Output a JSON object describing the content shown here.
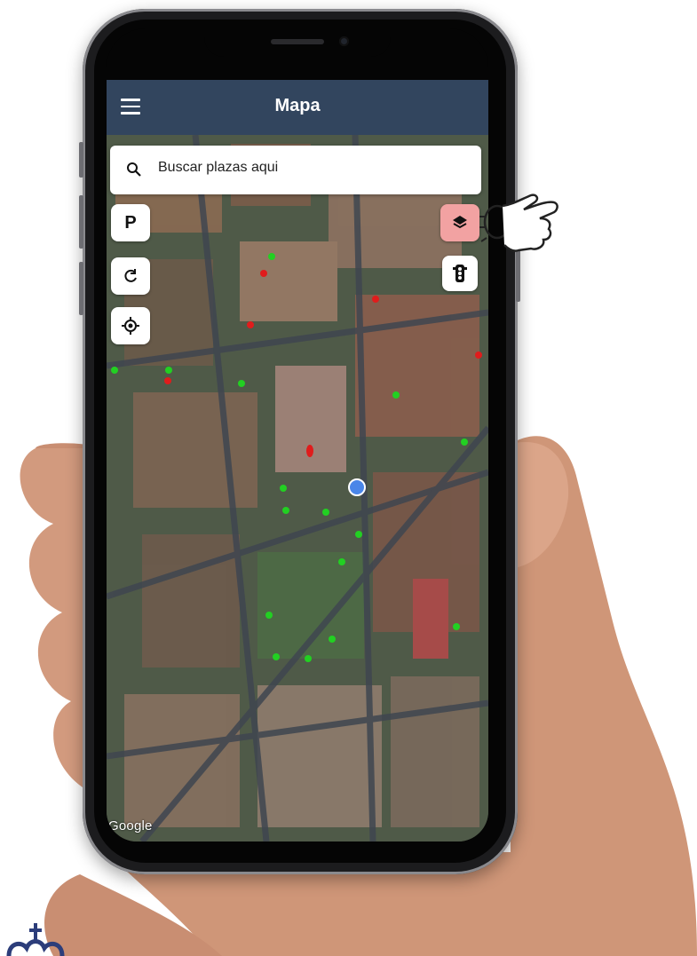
{
  "app": {
    "title": "Mapa"
  },
  "search": {
    "placeholder": "Buscar plazas aqui"
  },
  "controls": {
    "parking_label": "P"
  },
  "map": {
    "attribution": "Google",
    "imagery": "satellite",
    "current_location_marker": "blue-dot",
    "free_spot_color": "#22d022",
    "occupied_spot_color": "#e01c1c"
  },
  "icons": [
    "menu-icon",
    "search-icon",
    "refresh-icon",
    "locate-icon",
    "layers-icon",
    "traffic-light-icon"
  ],
  "colors": {
    "appbar": "#32455e",
    "layers_button": "#f2a2a2",
    "location_dot": "#4a86e8"
  }
}
